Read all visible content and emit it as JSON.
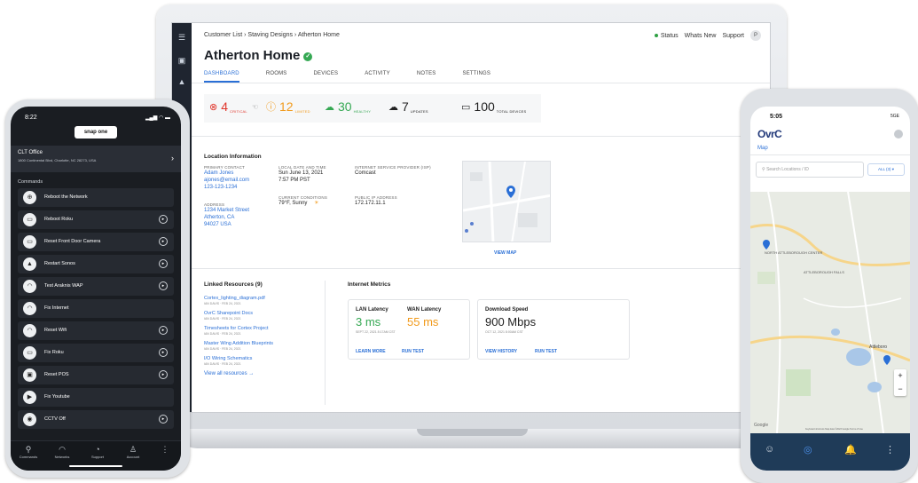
{
  "laptop": {
    "breadcrumb": "Customer List  ›  Staving Designs  ›  Atherton Home",
    "status": "Status",
    "whats_new": "Whats New",
    "support": "Support",
    "avatar": "P",
    "title": "Atherton Home",
    "tabs": [
      "DASHBOARD",
      "ROOMS",
      "DEVICES",
      "ACTIVITY",
      "NOTES",
      "SETTINGS"
    ],
    "stats": [
      {
        "value": "4",
        "label": "CRITICAL",
        "color": "#e0352b"
      },
      {
        "value": "12",
        "label": "LIMITED",
        "color": "#f19a1b"
      },
      {
        "value": "30",
        "label": "HEALTHY",
        "color": "#35a853"
      },
      {
        "value": "7",
        "label": "UPDATES",
        "color": "#222222"
      },
      {
        "value": "100",
        "label": "TOTAL DEVICES",
        "color": "#222222"
      }
    ],
    "location": {
      "heading": "Location Information",
      "primary_contact_h": "PRIMARY CONTACT",
      "contact_name": "Adam Jones",
      "contact_email": "ajones@email.com",
      "contact_phone": "123-123-1234",
      "local_date_h": "LOCAL DATE AND TIME",
      "date": "Sun June 13, 2021",
      "time": "7:57 PM PST",
      "isp_h": "INTERNET SERVICE PROVIDER (ISP)",
      "isp": "Comcast",
      "conditions_h": "CURRENT CONDITIONS",
      "conditions": "79°F, Sunny",
      "ip_h": "PUBLIC IP ADDRESS",
      "ip": "172.172.11.1",
      "address_h": "ADDRESS",
      "address1": "1234 Market Street",
      "address2": "Atherton, CA",
      "address3": "94027 USA",
      "view_map": "VIEW MAP"
    },
    "resources": {
      "heading": "Linked Resources (9)",
      "items": [
        {
          "name": "Cortex_lighting_diagram.pdf",
          "meta": "IAN DAVIS · FEB 24, 2021"
        },
        {
          "name": "OvrC Sharepoint Docs",
          "meta": "IAN DAVIS · FEB 24, 2021"
        },
        {
          "name": "Timesheets for Cortex Project",
          "meta": "IAN DAVIS · FEB 24, 2021"
        },
        {
          "name": "Master Wing Addition Blueprints",
          "meta": "IAN DAVIS · FEB 24, 2021"
        },
        {
          "name": "I/O Wiring Schematics",
          "meta": "IAN DAVIS · FEB 24, 2021"
        }
      ],
      "view_all": "View all resources  →"
    },
    "metrics": {
      "heading": "Internet Metrics",
      "lan_label": "LAN Latency",
      "lan_value": "3 ms",
      "wan_label": "WAN Latency",
      "wan_value": "55 ms",
      "latency_date": "SEPT 22, 2021 8:17AM CST",
      "learn_more": "LEARN MORE",
      "run_test": "RUN TEST",
      "dl_label": "Download Speed",
      "dl_value": "900 Mbps",
      "dl_date": "OCT 12, 2021 8:00AM CST",
      "view_history": "VIEW HISTORY",
      "run_test2": "RUN TEST"
    }
  },
  "phone_left": {
    "time": "8:22",
    "signal": "▂▄▆ ◠ ▬",
    "logo": "snap one",
    "office_title": "CLT Office",
    "office_address": "1800 Continental Blvd, Charlotte, NC 28273, USA",
    "commands_heading": "Commands",
    "commands": [
      {
        "label": "Reboot the Network",
        "icon": "⊕",
        "play": false
      },
      {
        "label": "Reboot Roku",
        "icon": "▭",
        "play": true
      },
      {
        "label": "Reset Front Door Camera",
        "icon": "▭",
        "play": true
      },
      {
        "label": "Restart Sonos",
        "icon": "▲",
        "play": true
      },
      {
        "label": "Test Araknis WAP",
        "icon": "◠",
        "play": true
      },
      {
        "label": "Fix Internet",
        "icon": "◠",
        "play": false
      },
      {
        "label": "Reset Wifi",
        "icon": "◠",
        "play": true
      },
      {
        "label": "Fix Roku",
        "icon": "▭",
        "play": true
      },
      {
        "label": "Reset POS",
        "icon": "▣",
        "play": true
      },
      {
        "label": "Fix Youtube",
        "icon": "▶",
        "play": false
      },
      {
        "label": "CCTV Off",
        "icon": "◉",
        "play": true
      }
    ],
    "nav": [
      "Commands",
      "Networks",
      "Support",
      "Account"
    ]
  },
  "phone_right": {
    "time": "5:05",
    "signal": "5GE",
    "logo": "OvrC",
    "map_label": "Map",
    "search_placeholder": "Search Locations / ID",
    "filter": "ALL (3)  ▾",
    "map_labels": [
      "NORTH ATTLEBOROUGH CENTER",
      "ATTLEBOROUGH FALLS",
      "Attleboro"
    ],
    "map_footer": "Keyboard shortcuts  Map data ©2023 Google  Terms of Use",
    "map_google": "Google"
  },
  "colors": {
    "accent": "#2a6fd6",
    "critical": "#e0352b",
    "limited": "#f19a1b",
    "healthy": "#35a853"
  }
}
